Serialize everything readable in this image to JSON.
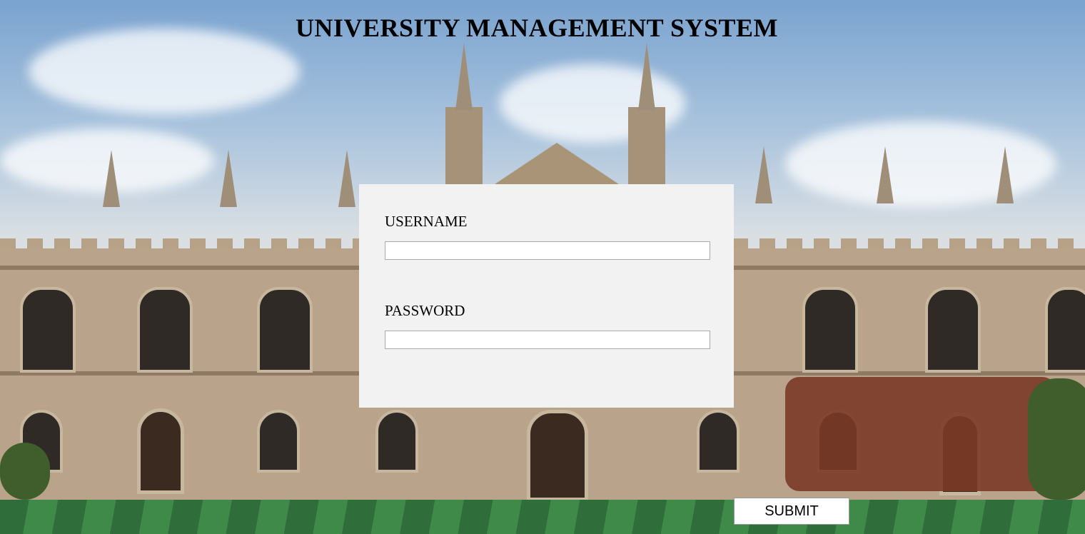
{
  "app": {
    "title": "UNIVERSITY MANAGEMENT SYSTEM"
  },
  "login": {
    "username_label": "USERNAME",
    "username_value": "",
    "password_label": "PASSWORD",
    "password_value": "",
    "submit_label": "SUBMIT"
  }
}
